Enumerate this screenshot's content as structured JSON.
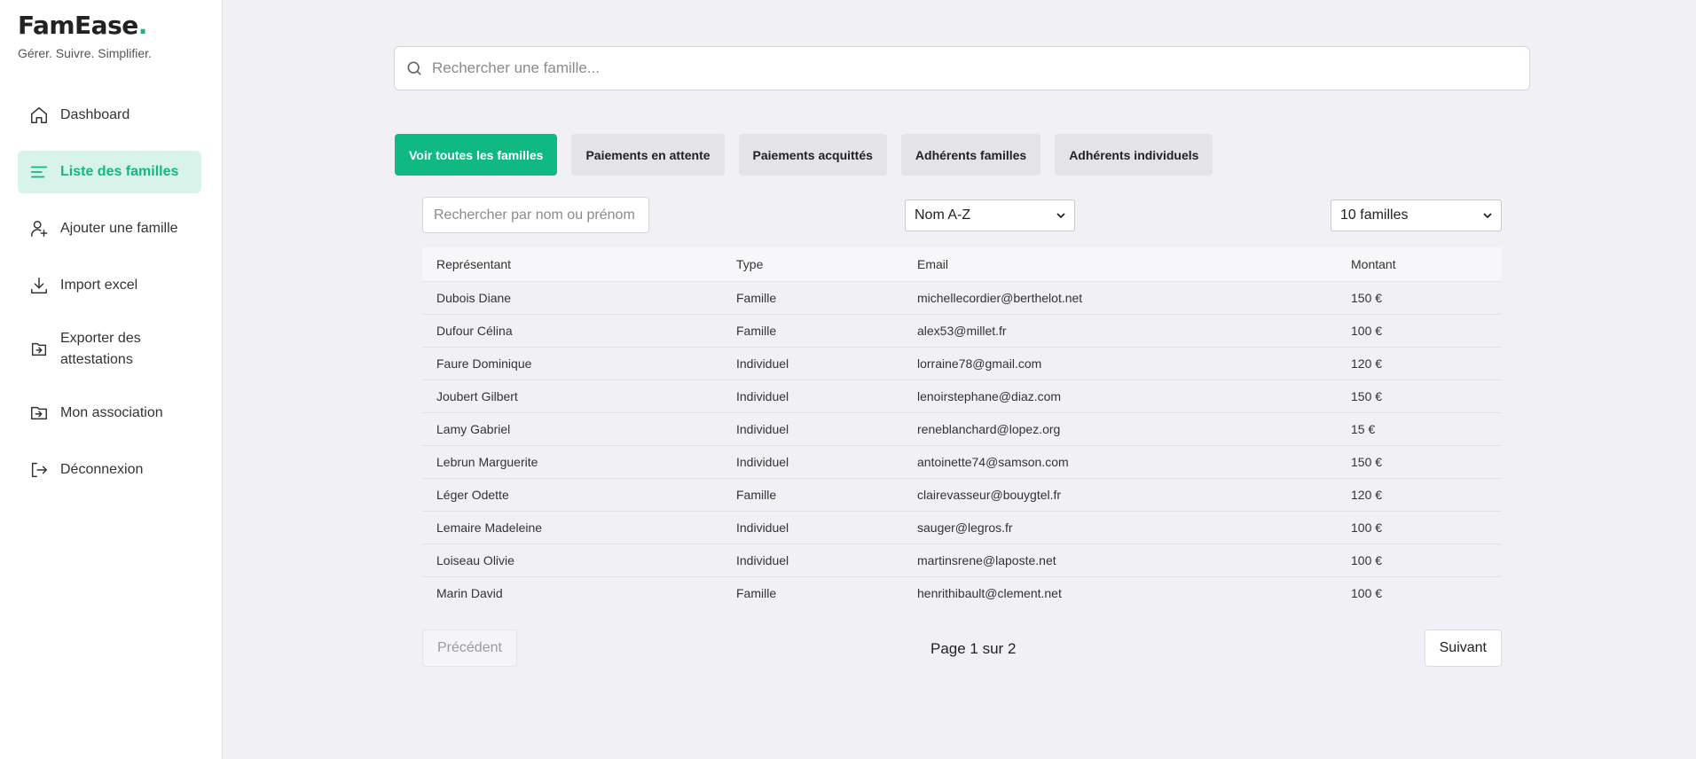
{
  "brand": {
    "name": "FamEase",
    "dot": ".",
    "tagline": "Gérer. Suivre. Simplifier.",
    "accent": "#10b981"
  },
  "sidebar": {
    "items": [
      {
        "label": "Dashboard",
        "icon": "home-icon"
      },
      {
        "label": "Liste des familles",
        "icon": "list-icon",
        "active": true
      },
      {
        "label": "Ajouter une famille",
        "icon": "add-user-icon"
      },
      {
        "label": "Import excel",
        "icon": "download-icon"
      },
      {
        "label": "Exporter des attestations",
        "icon": "export-icon"
      },
      {
        "label": "Mon association",
        "icon": "folder-icon"
      },
      {
        "label": "Déconnexion",
        "icon": "logout-icon"
      }
    ]
  },
  "search": {
    "placeholder": "Rechercher une famille..."
  },
  "filters": [
    "Voir toutes les familles",
    "Paiements en attente",
    "Paiements acquittés",
    "Adhérents familles",
    "Adhérents individuels"
  ],
  "table_tools": {
    "search_placeholder": "Rechercher par nom ou prénom",
    "sort_selected": "Nom A-Z",
    "count_selected": "10 familles"
  },
  "table": {
    "headers": [
      "Représentant",
      "Type",
      "Email",
      "Montant"
    ],
    "rows": [
      [
        "Dubois Diane",
        "Famille",
        "michellecordier@berthelot.net",
        "150 €"
      ],
      [
        "Dufour Célina",
        "Famille",
        "alex53@millet.fr",
        "100 €"
      ],
      [
        "Faure Dominique",
        "Individuel",
        "lorraine78@gmail.com",
        "120 €"
      ],
      [
        "Joubert Gilbert",
        "Individuel",
        "lenoirstephane@diaz.com",
        "150 €"
      ],
      [
        "Lamy Gabriel",
        "Individuel",
        "reneblanchard@lopez.org",
        "15 €"
      ],
      [
        "Lebrun Marguerite",
        "Individuel",
        "antoinette74@samson.com",
        "150 €"
      ],
      [
        "Léger Odette",
        "Famille",
        "clairevasseur@bouygtel.fr",
        "120 €"
      ],
      [
        "Lemaire Madeleine",
        "Individuel",
        "sauger@legros.fr",
        "100 €"
      ],
      [
        "Loiseau Olivie",
        "Individuel",
        "martinsrene@laposte.net",
        "100 €"
      ],
      [
        "Marin David",
        "Famille",
        "henrithibault@clement.net",
        "100 €"
      ]
    ]
  },
  "pagination": {
    "prev": "Précédent",
    "info": "Page 1 sur 2",
    "next": "Suivant"
  }
}
